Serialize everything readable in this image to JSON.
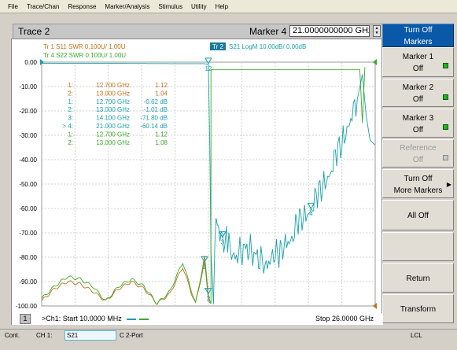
{
  "menu": [
    "File",
    "Trace/Chan",
    "Response",
    "Marker/Analysis",
    "Stimulus",
    "Utility",
    "Help"
  ],
  "header": {
    "trace_title": "Trace 2",
    "marker_label": "Marker 4",
    "marker_value": "21.0000000000 GHz"
  },
  "softkeys": [
    {
      "line1": "Turn Off",
      "line2": "Markers",
      "state": "active"
    },
    {
      "line1": "Marker 1",
      "line2": "Off",
      "state": "led-on"
    },
    {
      "line1": "Marker 2",
      "line2": "Off",
      "state": "led-on"
    },
    {
      "line1": "Marker 3",
      "line2": "Off",
      "state": "led-on"
    },
    {
      "line1": "Reference",
      "line2": "Off",
      "state": "disabled"
    },
    {
      "line1": "Turn Off",
      "line2": "More Markers",
      "state": "submenu"
    },
    {
      "line1": "All Off",
      "line2": "",
      "state": "normal"
    },
    {
      "line1": "",
      "line2": "",
      "state": "blank"
    },
    {
      "line1": "Return",
      "line2": "",
      "state": "normal"
    },
    {
      "line1": "Transform",
      "line2": "",
      "state": "normal"
    }
  ],
  "traces_legend": [
    {
      "text": "Tr 1  S11 SWR 0.100U/  1.00U",
      "color": "#c07018"
    },
    {
      "text": "Tr 4  S22 SWR 0.100U/  1.00U",
      "color": "#3aa82a"
    },
    {
      "badge": "Tr 2",
      "text": "S21 LogM 10.00dB/  0.00dB",
      "color": "#1aa0a8"
    }
  ],
  "marker_table": [
    {
      "idx": "1:",
      "freq": "12.700 GHz",
      "val": "1.12",
      "color": "#c07018"
    },
    {
      "idx": "2:",
      "freq": "13.000 GHz",
      "val": "1.04",
      "color": "#c07018"
    },
    {
      "idx": "1:",
      "freq": "12.700 GHz",
      "val": "-0.62 dB",
      "color": "#1aa0a8"
    },
    {
      "idx": "2:",
      "freq": "13.000 GHz",
      "val": "-1.01 dB",
      "color": "#1aa0a8"
    },
    {
      "idx": "3:",
      "freq": "14.100 GHz",
      "val": "-71.80 dB",
      "color": "#1aa0a8"
    },
    {
      "idx": "> 4:",
      "freq": "21.000 GHz",
      "val": "-60.14 dB",
      "color": "#1aa0a8"
    },
    {
      "idx": "1:",
      "freq": "12.700 GHz",
      "val": "1.12",
      "color": "#3aa82a"
    },
    {
      "idx": "2:",
      "freq": "13.000 GHz",
      "val": "1.08",
      "color": "#3aa82a"
    }
  ],
  "footer": {
    "channel_badge": "1",
    "start_text": ">Ch1: Start  10.0000 MHz",
    "stop_text": "Stop  26.0000 GHz"
  },
  "status": {
    "cont": "Cont.",
    "ch": "CH 1:",
    "param": "S21",
    "cal": "C  2-Port",
    "lcl": "LCL"
  },
  "colors": {
    "s11": "#c07018",
    "s21": "#1aa0a8",
    "s22": "#3aa82a",
    "softkey_active": "#0a58a8"
  },
  "chart_data": {
    "type": "line",
    "x_range_ghz": [
      0.01,
      26.0
    ],
    "y_ticks": [
      "0.00",
      "-10.00",
      "-20.00",
      "-30.00",
      "-40.00",
      "-50.00",
      "-60.00",
      "-70.00",
      "-80.00",
      "-90.00",
      "-100.00"
    ],
    "ylim": [
      -100,
      0
    ],
    "grid": true,
    "series": [
      {
        "name": "S21",
        "color": "#1aa0a8",
        "points": [
          [
            0.01,
            -0.5
          ],
          [
            5,
            -0.5
          ],
          [
            10,
            -0.6
          ],
          [
            12,
            -0.6
          ],
          [
            12.7,
            -0.62
          ],
          [
            13.0,
            -1.01
          ],
          [
            13.1,
            -30
          ],
          [
            13.2,
            -78
          ],
          [
            13.4,
            -97
          ],
          [
            13.6,
            -65
          ],
          [
            14.1,
            -71.8
          ],
          [
            14.5,
            -75
          ],
          [
            15,
            -80
          ],
          [
            16,
            -76
          ],
          [
            17,
            -81
          ],
          [
            17.5,
            -84
          ],
          [
            18,
            -78
          ],
          [
            18.5,
            -80
          ],
          [
            19,
            -74
          ],
          [
            19.5,
            -72
          ],
          [
            20,
            -66
          ],
          [
            20.5,
            -63
          ],
          [
            21.0,
            -60.14
          ],
          [
            21.5,
            -55
          ],
          [
            22,
            -50
          ],
          [
            22.5,
            -45
          ],
          [
            23,
            -38
          ],
          [
            23.5,
            -32
          ],
          [
            24,
            -24
          ],
          [
            24.5,
            -18
          ],
          [
            25,
            -5
          ],
          [
            25.3,
            -22
          ],
          [
            25.6,
            -32
          ],
          [
            26,
            -34
          ]
        ]
      },
      {
        "name": "S11",
        "color": "#c07018",
        "points": [
          [
            0.01,
            -98
          ],
          [
            1,
            -93
          ],
          [
            2,
            -90
          ],
          [
            3,
            -91
          ],
          [
            4,
            -94
          ],
          [
            5,
            -98
          ],
          [
            6,
            -93
          ],
          [
            7,
            -90
          ],
          [
            8,
            -93
          ],
          [
            9,
            -99
          ],
          [
            10,
            -95
          ],
          [
            11,
            -84
          ],
          [
            11.7,
            -95
          ],
          [
            12,
            -99
          ],
          [
            12.7,
            -80
          ],
          [
            13.0,
            -95
          ],
          [
            13.2,
            -99
          ]
        ]
      },
      {
        "name": "S22",
        "color": "#3aa82a",
        "points": [
          [
            0.01,
            -97
          ],
          [
            1,
            -92
          ],
          [
            2,
            -88
          ],
          [
            3,
            -89
          ],
          [
            4,
            -92
          ],
          [
            5,
            -98
          ],
          [
            6,
            -92
          ],
          [
            7,
            -89
          ],
          [
            8,
            -92
          ],
          [
            9,
            -99
          ],
          [
            10,
            -94
          ],
          [
            11,
            -82
          ],
          [
            11.7,
            -94
          ],
          [
            12,
            -99
          ],
          [
            12.7,
            -82
          ],
          [
            13.0,
            -97
          ],
          [
            13.2,
            -99
          ],
          [
            13.2,
            -3
          ],
          [
            24.8,
            -3
          ],
          [
            25.0,
            -25
          ],
          [
            25.2,
            -2
          ]
        ]
      }
    ],
    "markers": [
      {
        "label": "12",
        "x": 13.0,
        "y": -0.62
      },
      {
        "label": "3",
        "x": 14.1,
        "y": -71.8
      },
      {
        "label": "4",
        "x": 21.0,
        "y": -60.14
      },
      {
        "label": "1",
        "x": 12.7,
        "y": -82
      },
      {
        "label": "2",
        "x": 13.0,
        "y": -95
      }
    ]
  }
}
